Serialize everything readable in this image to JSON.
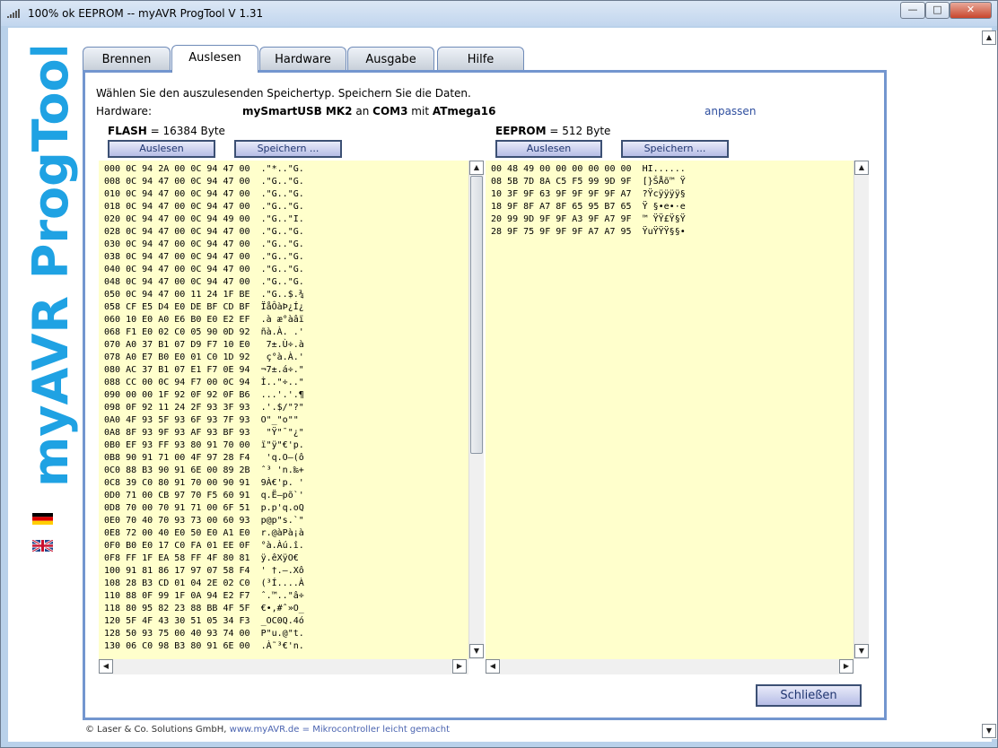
{
  "window": {
    "title": "100% ok EEPROM -- myAVR ProgTool V 1.31",
    "min": "—",
    "max": "□",
    "close": "✕"
  },
  "logo": {
    "text": "myAVR ProgTool",
    "brand_color": "#1fa2e3"
  },
  "tabs": [
    {
      "label": "Brennen"
    },
    {
      "label": "Auslesen"
    },
    {
      "label": "Hardware"
    },
    {
      "label": "Ausgabe"
    },
    {
      "label": "Hilfe"
    }
  ],
  "panel": {
    "instruction": "Wählen Sie den auszulesenden Speichertyp. Speichern Sie die Daten.",
    "hardware_label": "Hardware:",
    "hw_device": "mySmartUSB MK2",
    "hw_an": "an",
    "hw_port": "COM3",
    "hw_mit": "mit",
    "hw_chip": "ATmega16",
    "anpassen": "anpassen"
  },
  "flash": {
    "name": "FLASH",
    "size": "= 16384 Byte",
    "read_label": "Auslesen",
    "save_label": "Speichern ...",
    "rows": [
      "000 0C 94 2A 00 0C 94 47 00  .\"*..\"G.",
      "008 0C 94 47 00 0C 94 47 00  .\"G..\"G.",
      "010 0C 94 47 00 0C 94 47 00  .\"G..\"G.",
      "018 0C 94 47 00 0C 94 47 00  .\"G..\"G.",
      "020 0C 94 47 00 0C 94 49 00  .\"G..\"I.",
      "028 0C 94 47 00 0C 94 47 00  .\"G..\"G.",
      "030 0C 94 47 00 0C 94 47 00  .\"G..\"G.",
      "038 0C 94 47 00 0C 94 47 00  .\"G..\"G.",
      "040 0C 94 47 00 0C 94 47 00  .\"G..\"G.",
      "048 0C 94 47 00 0C 94 47 00  .\"G..\"G.",
      "050 0C 94 47 00 11 24 1F BE  .\"G..$.¾",
      "058 CF E5 D4 E0 DE BF CD BF  ÏåÔàÞ¿Í¿",
      "060 10 E0 A0 E6 B0 E0 E2 EF  .à æ°àâï",
      "068 F1 E0 02 C0 05 90 0D 92  ñà.À. .'",
      "070 A0 37 B1 07 D9 F7 10 E0   7±.Ù÷.à",
      "078 A0 E7 B0 E0 01 C0 1D 92   ç°à.À.'",
      "080 AC 37 B1 07 E1 F7 0E 94  ¬7±.á÷.\"",
      "088 CC 00 0C 94 F7 00 0C 94  Ì..\"÷..\"",
      "090 00 00 1F 92 0F 92 0F B6  ...'.'.¶",
      "098 0F 92 11 24 2F 93 3F 93  .'.$/\"?\"",
      "0A0 4F 93 5F 93 6F 93 7F 93  O\"_\"o\"\"",
      "0A8 8F 93 9F 93 AF 93 BF 93   \"Ÿ\"¯\"¿\"",
      "0B0 EF 93 FF 93 80 91 70 00  ï\"ÿ\"€'p.",
      "0B8 90 91 71 00 4F 97 28 F4   'q.O—(ô",
      "0C0 88 B3 90 91 6E 00 89 2B  ˆ³ 'n.‰+",
      "0C8 39 C0 80 91 70 00 90 91  9À€'p. '",
      "0D0 71 00 CB 97 70 F5 60 91  q.Ë—põ`'",
      "0D8 70 00 70 91 71 00 6F 51  p.p'q.oQ",
      "0E0 70 40 70 93 73 00 60 93  p@p\"s.`\"",
      "0E8 72 00 40 E0 50 E0 A1 E0  r.@àPà¡à",
      "0F0 B0 E0 17 C0 FA 01 EE 0F  °à.Àú.î.",
      "0F8 FF 1F EA 58 FF 4F 80 81  ÿ.êXÿO€",
      "100 91 81 86 17 97 07 58 F4  ' †.—.Xô",
      "108 28 B3 CD 01 04 2E 02 C0  (³Í....À",
      "110 88 0F 99 1F 0A 94 E2 F7  ˆ.™..\"â÷",
      "118 80 95 82 23 88 BB 4F 5F  €•‚#ˆ»O_",
      "120 5F 4F 43 30 51 05 34 F3  _OC0Q.4ó",
      "128 50 93 75 00 40 93 74 00  P\"u.@\"t.",
      "130 06 C0 98 B3 80 91 6E 00  .À˜³€'n."
    ]
  },
  "eeprom": {
    "name": "EEPROM",
    "size": "= 512 Byte",
    "read_label": "Auslesen",
    "save_label": "Speichern ...",
    "rows": [
      "00 48 49 00 00 00 00 00 00  HI......",
      "08 5B 7D 8A C5 F5 99 9D 9F  [}ŠÅõ™ Ÿ",
      "10 3F 9F 63 9F 9F 9F 9F A7  ?Ÿcÿÿÿÿ§",
      "18 9F 8F A7 8F 65 95 B7 65  Ÿ §•e•·e",
      "20 99 9D 9F 9F A3 9F A7 9F  ™ ŸŸ£Ÿ§Ÿ",
      "28 9F 75 9F 9F 9F A7 A7 95  ŸuŸŸŸ§§•"
    ]
  },
  "buttons": {
    "close": "Schließen"
  },
  "footer": {
    "copyright": "© Laser & Co. Solutions GmbH,",
    "site": "www.myAVR.de",
    "eq": "=",
    "tagline": "Mikrocontroller leicht gemacht"
  }
}
